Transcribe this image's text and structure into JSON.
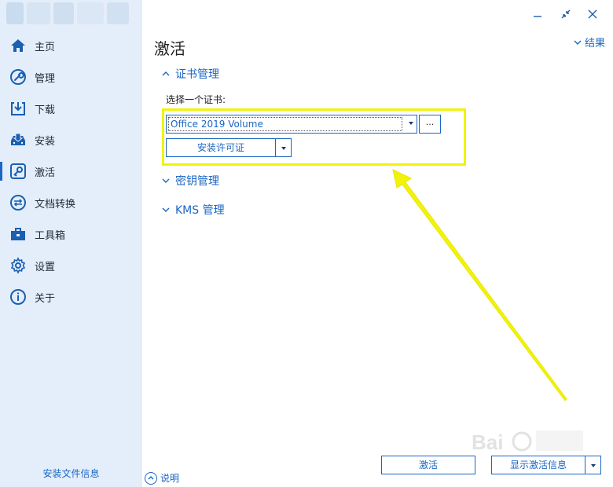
{
  "sidebar": {
    "items": [
      {
        "label": "主页",
        "icon": "home-icon"
      },
      {
        "label": "管理",
        "icon": "wrench-icon"
      },
      {
        "label": "下载",
        "icon": "download-icon"
      },
      {
        "label": "安装",
        "icon": "install-tray-icon"
      },
      {
        "label": "激活",
        "icon": "key-icon",
        "active": true
      },
      {
        "label": "文档转换",
        "icon": "convert-arrows-icon"
      },
      {
        "label": "工具箱",
        "icon": "toolbox-icon"
      },
      {
        "label": "设置",
        "icon": "gear-icon"
      },
      {
        "label": "关于",
        "icon": "info-icon"
      }
    ],
    "footer_link": "安装文件信息"
  },
  "page": {
    "title": "激活",
    "results_link": "结果"
  },
  "sections": {
    "certificate": {
      "title": "证书管理",
      "label": "选择一个证书:",
      "selected": "Office 2019 Volume",
      "browse_label": "...",
      "install_label": "安装许可证"
    },
    "key": {
      "title": "密钥管理"
    },
    "kms": {
      "title": "KMS 管理"
    }
  },
  "bottom": {
    "help_label": "说明",
    "activate_label": "激活",
    "show_info_label": "显示激活信息"
  },
  "colors": {
    "accent": "#1a66c4",
    "sidebar_bg": "#e4eefa",
    "annotation": "#f2f20a"
  }
}
